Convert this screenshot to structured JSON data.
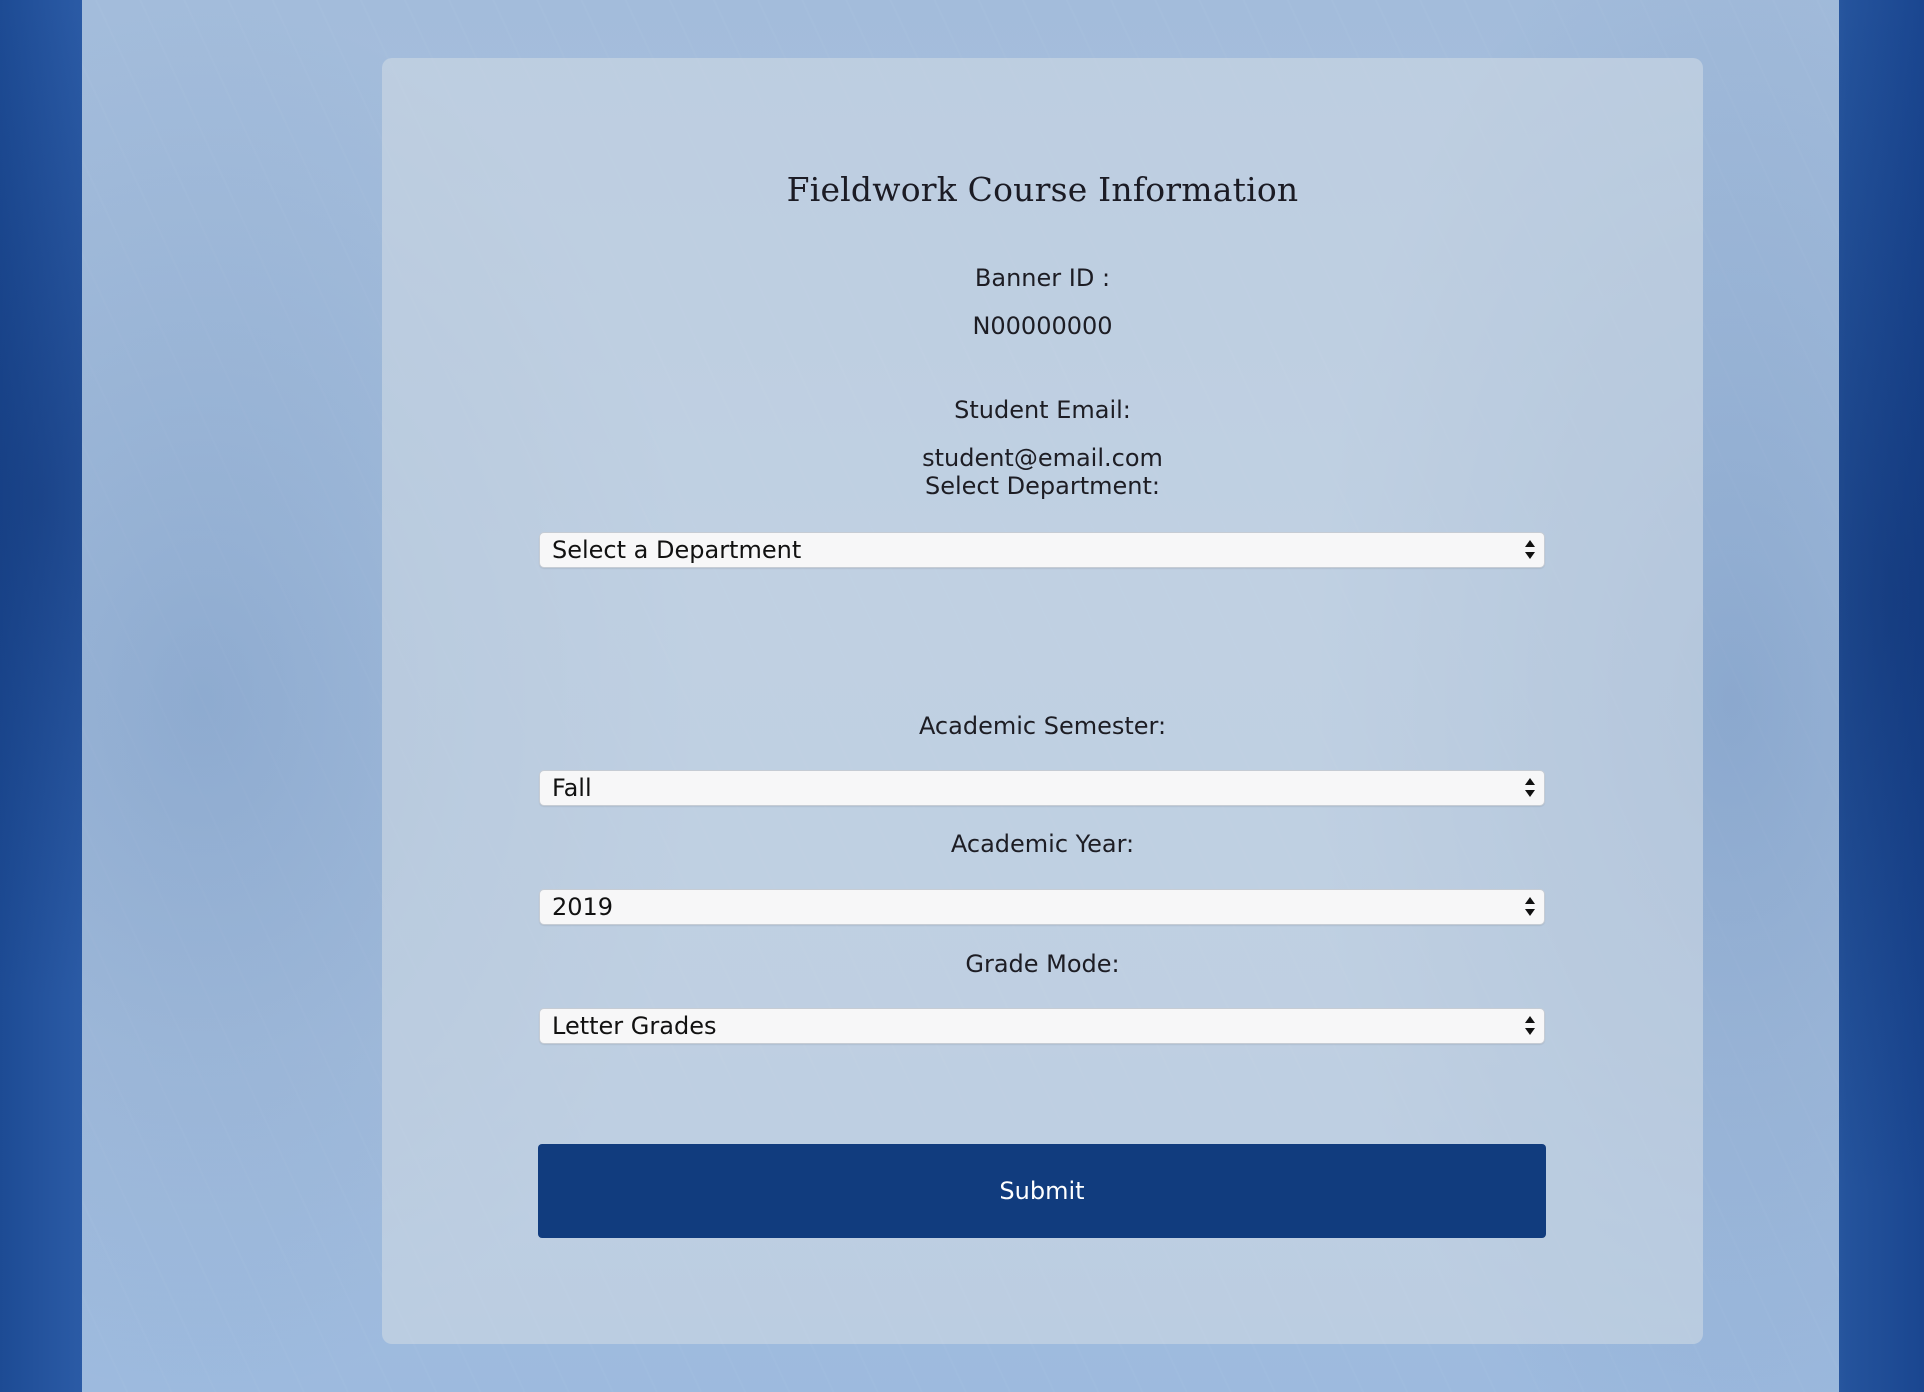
{
  "page": {
    "title": "Fieldwork Course Information"
  },
  "banner": {
    "label": "Banner ID :",
    "value": "N00000000"
  },
  "email": {
    "label": "Student Email:",
    "value": "student@email.com"
  },
  "department": {
    "label": "Select Department:",
    "selected": "Select a Department"
  },
  "semester": {
    "label": "Academic Semester:",
    "selected": "Fall"
  },
  "year": {
    "label": "Academic Year:",
    "selected": "2019"
  },
  "grade_mode": {
    "label": "Grade Mode:",
    "selected": "Letter Grades"
  },
  "submit": {
    "label": "Submit"
  },
  "colors": {
    "primary_button": "#113c7e",
    "outer_background": "#24539c",
    "card_background": "#cdd8e4"
  },
  "icons": {
    "select_arrow": "up-down-arrows-icon"
  }
}
